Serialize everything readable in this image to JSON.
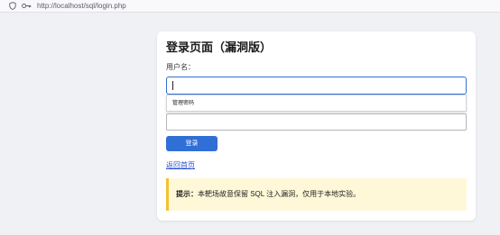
{
  "browser": {
    "url": "http://localhost/sql/login.php"
  },
  "page": {
    "title": "登录页面（漏洞版）",
    "username_label": "用户名：",
    "username_value": "",
    "autocomplete_suggestion": "管理密码",
    "password_value": "",
    "login_button": "登录",
    "back_link": "返回首页",
    "tip_label": "提示：",
    "tip_text": "本靶场故意保留 SQL 注入漏洞，仅用于本地实验。"
  },
  "colors": {
    "accent": "#2f6fd6",
    "tip_border": "#f2c230",
    "tip_background": "#fff8d8",
    "link": "#2a4fd1"
  }
}
